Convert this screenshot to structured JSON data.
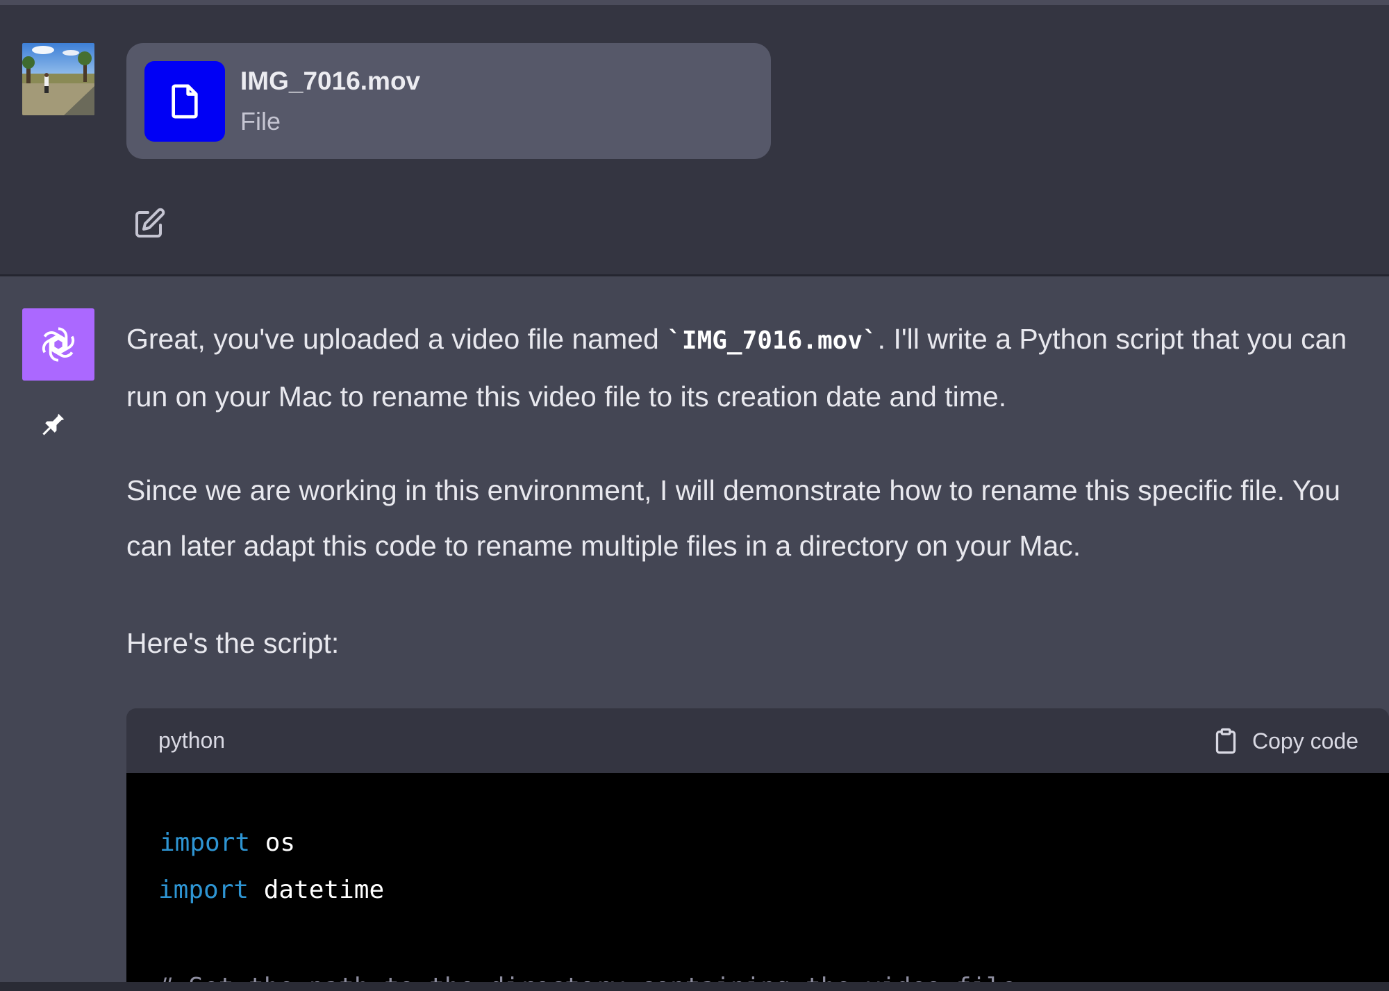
{
  "colors": {
    "user_background": "#343541",
    "assistant_background": "#444654",
    "file_chip": "#565869",
    "file_icon_bg": "#0000f5",
    "gpt_avatar_bg": "#ab68ff",
    "code_header_bg": "#343541",
    "code_body_bg": "#000000",
    "keyword": "#2e95d3",
    "comment": "#8e8ea0"
  },
  "user_message": {
    "avatar_icon": "user-photo",
    "attachment": {
      "icon": "document-icon",
      "name": "IMG_7016.mov",
      "type": "File"
    },
    "edit_icon": "edit-icon"
  },
  "assistant_message": {
    "avatar_icon": "openai-logo-icon",
    "pin_icon": "pin-icon",
    "paragraphs": {
      "p1_before": "Great, you've uploaded a video file named ",
      "p1_code": "`IMG_7016.mov`",
      "p1_after": ". I'll write a Python script that you can run on your Mac to rename this video file to its creation date and time.",
      "p2": "Since we are working in this environment, I will demonstrate how to rename this specific file. You can later adapt this code to rename multiple files in a directory on your Mac.",
      "p3": "Here's the script:"
    },
    "code_block": {
      "language": "python",
      "copy_label": "Copy code",
      "copy_icon": "clipboard-icon",
      "lines": {
        "l1_kw": "import",
        "l1_rest": " os",
        "l2_kw": "import",
        "l2_rest": " datetime",
        "l3_comment": "# Set the path to the directory containing the video file"
      }
    }
  }
}
